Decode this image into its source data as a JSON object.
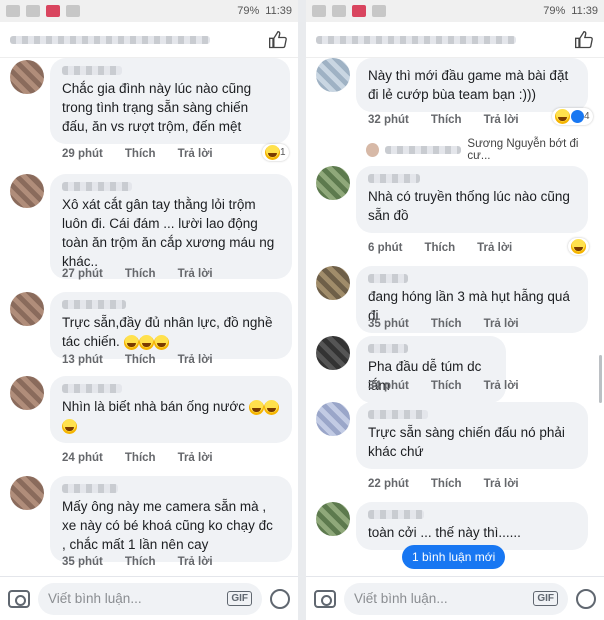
{
  "status": {
    "battery": "79%",
    "time": "11:39"
  },
  "left": {
    "comments": [
      {
        "text": "Chắc gia đình này lúc nào cũng trong tình trạng sẵn sàng chiến đấu, ăn vs rượt trộm, đến mệt",
        "time": "29 phút",
        "like": "Thích",
        "reply": "Trả lời",
        "react_count": "1"
      },
      {
        "text": "Xô xát cắt gân tay thằng lỏi trộm luôn đi. Cái đám ... lười lao động toàn ăn trộm ăn cắp xương máu ng khác..",
        "time": "27 phút",
        "like": "Thích",
        "reply": "Trả lời"
      },
      {
        "text": "Trực sẵn,đầy đủ nhân lực, đồ nghề tác chiến.",
        "time": "13 phút",
        "like": "Thích",
        "reply": "Trả lời"
      },
      {
        "text": "Nhìn là biết nhà bán ống nước",
        "time": "24 phút",
        "like": "Thích",
        "reply": "Trả lời"
      },
      {
        "text": "Mấy ông này me camera sẵn mà , xe này có bé khoá cũng ko chạy đc , chắc mất 1 lần nên cay",
        "time": "35 phút",
        "like": "Thích",
        "reply": "Trả lời"
      }
    ],
    "composer_placeholder": "Viết bình luận...",
    "gif": "GIF"
  },
  "right": {
    "comments": [
      {
        "text": "Này thì mới đầu game mà bài đặt đi lẻ cướp bùa team bạn :)))",
        "time": "32 phút",
        "like": "Thích",
        "reply": "Trả lời",
        "react_count": "4"
      },
      {
        "text": "Nhà có truyền thống lúc nào cũng sẵn đồ",
        "time": "6 phút",
        "like": "Thích",
        "reply": "Trả lời"
      },
      {
        "text": "đang hóng lần 3 mà hụt hẫng quá đi",
        "time": "35 phút",
        "like": "Thích",
        "reply": "Trả lời"
      },
      {
        "text": "Pha đầu dễ túm dc lắm",
        "time": "34 phút",
        "like": "Thích",
        "reply": "Trả lời"
      },
      {
        "text": "Trực sẵn sàng chiến đấu nó phải khác chứ",
        "time": "22 phút",
        "like": "Thích",
        "reply": "Trả lời"
      },
      {
        "text": "toàn cởi ... thế này thì......",
        "time": "",
        "like": "",
        "reply": ""
      }
    ],
    "reply_line": "Sương Nguyễn bớt đi cư...",
    "new_comment_btn": "1 bình luận mới",
    "composer_placeholder": "Viết bình luận...",
    "gif": "GIF"
  }
}
